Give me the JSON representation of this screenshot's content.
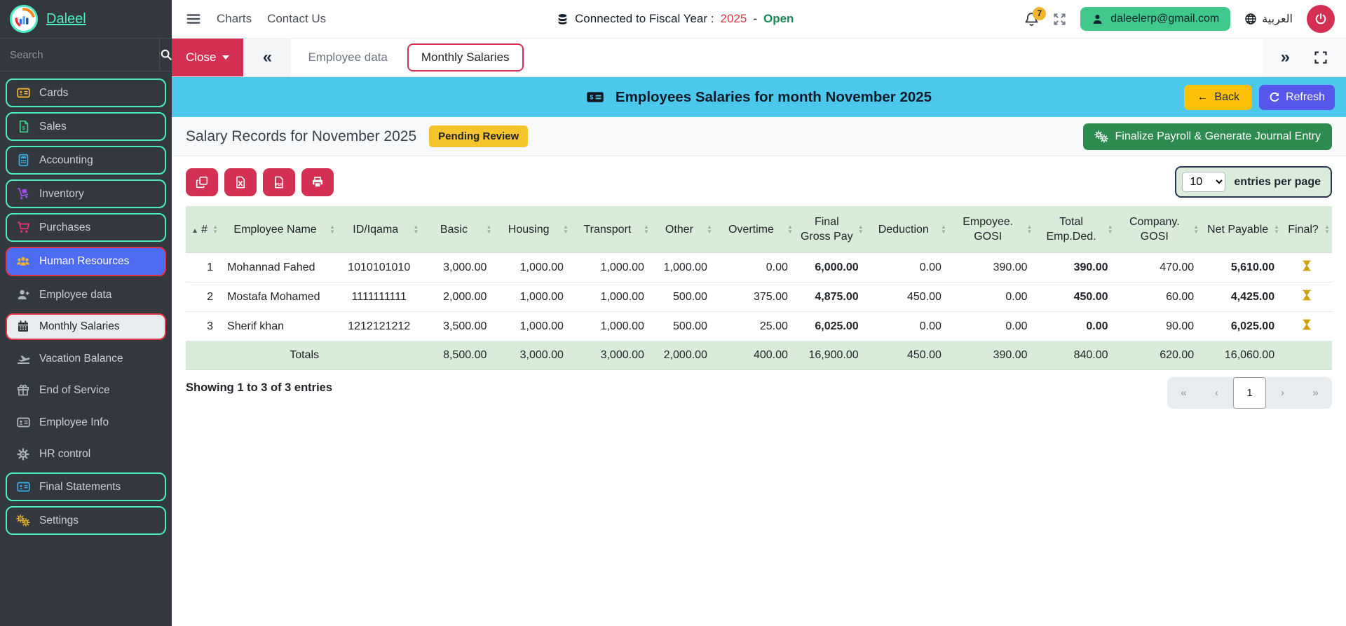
{
  "brand": {
    "name": "Daleel",
    "search_placeholder": "Search"
  },
  "topbar": {
    "menu": [
      "Charts",
      "Contact Us"
    ],
    "fiscal_prefix": "Connected to Fiscal Year :",
    "fiscal_year": "2025",
    "fiscal_sep": "-",
    "fiscal_status": "Open",
    "notifications_count": "7",
    "email": "daleelerp@gmail.com",
    "language": "العربية"
  },
  "sidebar": {
    "items": [
      {
        "label": "Cards",
        "icon": "id-card-icon"
      },
      {
        "label": "Sales",
        "icon": "invoice-dollar-icon"
      },
      {
        "label": "Accounting",
        "icon": "calculator-icon"
      },
      {
        "label": "Inventory",
        "icon": "dolly-icon"
      },
      {
        "label": "Purchases",
        "icon": "cart-icon"
      },
      {
        "label": "Human Resources",
        "icon": "users-icon"
      },
      {
        "label": "Employee data",
        "icon": "user-plus-icon"
      },
      {
        "label": "Monthly Salaries",
        "icon": "calendar-icon"
      },
      {
        "label": "Vacation Balance",
        "icon": "plane-departure-icon"
      },
      {
        "label": "End of Service",
        "icon": "gift-icon"
      },
      {
        "label": "Employee Info",
        "icon": "id-card-icon"
      },
      {
        "label": "HR control",
        "icon": "gear-icon"
      },
      {
        "label": "Final Statements",
        "icon": "id-card-icon"
      },
      {
        "label": "Settings",
        "icon": "gears-icon"
      }
    ]
  },
  "tabbar": {
    "close_label": "Close",
    "tabs": [
      {
        "label": "Employee data"
      },
      {
        "label": "Monthly Salaries"
      }
    ]
  },
  "page_header": {
    "title": "Employees Salaries for month November 2025",
    "back_label": "Back",
    "refresh_label": "Refresh"
  },
  "toolbar": {
    "heading": "Salary Records for November 2025",
    "status_badge": "Pending Review",
    "finalize_label": "Finalize Payroll & Generate Journal Entry",
    "export_buttons": [
      "copy",
      "excel",
      "pdf",
      "print"
    ],
    "page_size_value": "10",
    "page_size_label": "entries per page"
  },
  "table": {
    "columns": [
      "#",
      "Employee Name",
      "ID/Iqama",
      "Basic",
      "Housing",
      "Transport",
      "Other",
      "Overtime",
      "Final Gross Pay",
      "Deduction",
      "Empoyee. GOSI",
      "Total Emp.Ded.",
      "Company. GOSI",
      "Net Payable",
      "Final?"
    ],
    "rows": [
      {
        "num": "1",
        "name": "Mohannad Fahed",
        "id": "1010101010",
        "basic": "3,000.00",
        "housing": "1,000.00",
        "transport": "1,000.00",
        "other": "1,000.00",
        "overtime": "0.00",
        "gross": "6,000.00",
        "deduction": "0.00",
        "emp_gosi": "390.00",
        "total_ded": "390.00",
        "co_gosi": "470.00",
        "net": "5,610.00",
        "final_icon": "hourglass-icon"
      },
      {
        "num": "2",
        "name": "Mostafa Mohamed",
        "id": "1111111111",
        "basic": "2,000.00",
        "housing": "1,000.00",
        "transport": "1,000.00",
        "other": "500.00",
        "overtime": "375.00",
        "gross": "4,875.00",
        "deduction": "450.00",
        "emp_gosi": "0.00",
        "total_ded": "450.00",
        "co_gosi": "60.00",
        "net": "4,425.00",
        "final_icon": "hourglass-icon"
      },
      {
        "num": "3",
        "name": "Sherif khan",
        "id": "1212121212",
        "basic": "3,500.00",
        "housing": "1,000.00",
        "transport": "1,000.00",
        "other": "500.00",
        "overtime": "25.00",
        "gross": "6,025.00",
        "deduction": "0.00",
        "emp_gosi": "0.00",
        "total_ded": "0.00",
        "co_gosi": "90.00",
        "net": "6,025.00",
        "final_icon": "hourglass-icon"
      }
    ],
    "totals": {
      "label": "Totals",
      "basic": "8,500.00",
      "housing": "3,000.00",
      "transport": "3,000.00",
      "other": "2,000.00",
      "overtime": "400.00",
      "gross": "16,900.00",
      "deduction": "450.00",
      "emp_gosi": "390.00",
      "total_ded": "840.00",
      "co_gosi": "620.00",
      "net": "16,060.00"
    }
  },
  "footer": {
    "showing": "Showing 1 to 3 of 3 entries",
    "pagination": [
      "«",
      "‹",
      "1",
      "›",
      "»"
    ]
  },
  "colors": {
    "sidebar_bg": "#32383e",
    "accent_mint": "#4eecc4",
    "crimson": "#d43054",
    "active_blue": "#4e6bf4",
    "header_cyan": "#4dc8ed",
    "back_yellow": "#ffc107",
    "refresh_indigo": "#5757ec",
    "finalize_green": "#2e8b4f",
    "email_green": "#41c98c",
    "table_header_green": "#d9ebd9",
    "badge_yellow": "#f5c32c",
    "fiscal_year_red": "#dc3545",
    "fiscal_open_green": "#188a55",
    "hourglass_gold": "#cfa008"
  }
}
